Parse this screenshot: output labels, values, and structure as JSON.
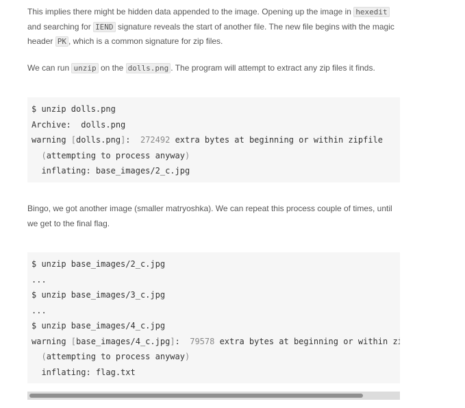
{
  "p1": {
    "t1": "This implies there might be hidden data appended to the image. Opening up the image in ",
    "c1": "hexedit",
    "t2": " and searching for ",
    "c2": "IEND",
    "t3": " signature reveals the start of another file. The new file begins with the magic header ",
    "c3": "PK",
    "t4": ", which is a common signature for zip files."
  },
  "p2": {
    "t1": "We can run ",
    "c1": "unzip",
    "t2": " on the ",
    "c2": "dolls.png",
    "t3": ". The program will attempt to extract any zip files it finds."
  },
  "code1": {
    "l1": "$ unzip dolls.png",
    "l2": "Archive:  dolls.png",
    "l3a": "warning ",
    "l3b": "[",
    "l3c": "dolls.png",
    "l3d": "]",
    "l3e": ":  ",
    "l3f": "272492",
    "l3g": " extra bytes at beginning or within zipfile",
    "l4a": "  (",
    "l4b": "attempting to process anyway",
    "l4c": ")",
    "l5": "  inflating: base_images/2_c.jpg"
  },
  "p3": {
    "text": "Bingo, we got another image (smaller matryoshka). We can repeat this process couple of times, until we get to the final flag."
  },
  "code2": {
    "l1": "$ unzip base_images/2_c.jpg",
    "l2": "...",
    "l3": "$ unzip base_images/3_c.jpg",
    "l4": "...",
    "l5": "$ unzip base_images/4_c.jpg",
    "l6a": "warning ",
    "l6b": "[",
    "l6c": "base_images/4_c.jpg",
    "l6d": "]",
    "l6e": ":  ",
    "l6f": "79578",
    "l6g": " extra bytes at beginning or within zipfile",
    "l7a": "  (",
    "l7b": "attempting to process anyway",
    "l7c": ")",
    "l8": "  inflating: flag.txt"
  },
  "scrollbar": {
    "thumb_fraction": 0.9
  }
}
